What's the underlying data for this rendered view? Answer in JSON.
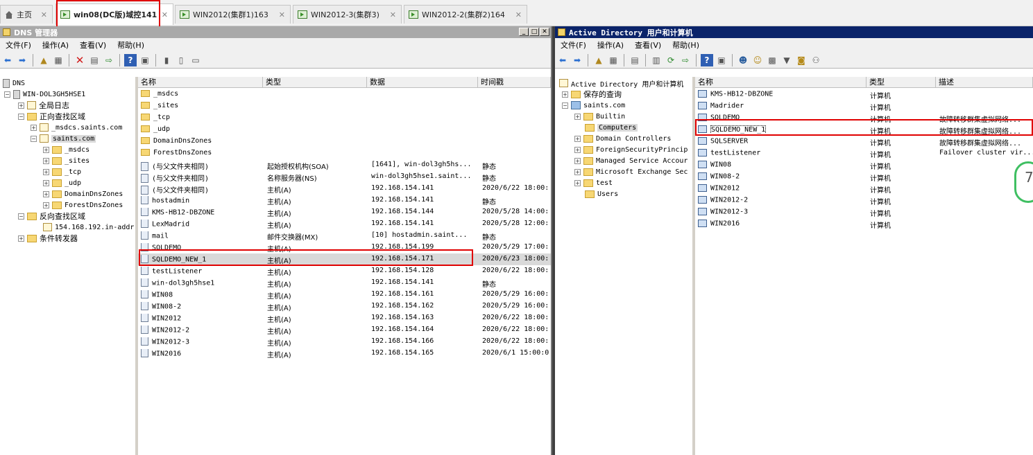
{
  "tabs": [
    {
      "label": "主页"
    },
    {
      "label": "win08(DC版)域控141"
    },
    {
      "label": "WIN2012(集群1)163"
    },
    {
      "label": "WIN2012-3(集群3)"
    },
    {
      "label": "WIN2012-2(集群2)164"
    }
  ],
  "dns": {
    "title": "DNS 管理器",
    "menu": [
      "文件(F)",
      "操作(A)",
      "查看(V)",
      "帮助(H)"
    ],
    "tree": [
      {
        "label": "DNS"
      },
      {
        "label": "WIN-DOL3GH5HSE1"
      },
      {
        "label": "全局日志"
      },
      {
        "label": "正向查找区域"
      },
      {
        "label": "_msdcs.saints.com"
      },
      {
        "label": "saints.com"
      },
      {
        "label": "_msdcs"
      },
      {
        "label": "_sites"
      },
      {
        "label": "_tcp"
      },
      {
        "label": "_udp"
      },
      {
        "label": "DomainDnsZones"
      },
      {
        "label": "ForestDnsZones"
      },
      {
        "label": "反向查找区域"
      },
      {
        "label": "154.168.192.in-addr"
      },
      {
        "label": "条件转发器"
      }
    ],
    "columns": [
      "名称",
      "类型",
      "数据",
      "时间戳"
    ],
    "rows": [
      {
        "name": "_msdcs",
        "type": "",
        "data": "",
        "time": ""
      },
      {
        "name": "_sites",
        "type": "",
        "data": "",
        "time": ""
      },
      {
        "name": "_tcp",
        "type": "",
        "data": "",
        "time": ""
      },
      {
        "name": "_udp",
        "type": "",
        "data": "",
        "time": ""
      },
      {
        "name": "DomainDnsZones",
        "type": "",
        "data": "",
        "time": ""
      },
      {
        "name": "ForestDnsZones",
        "type": "",
        "data": "",
        "time": ""
      },
      {
        "name": "(与父文件夹相同)",
        "type": "起始授权机构(SOA)",
        "data": "[1641], win-dol3gh5hs...",
        "time": "静态"
      },
      {
        "name": "(与父文件夹相同)",
        "type": "名称服务器(NS)",
        "data": "win-dol3gh5hse1.saint...",
        "time": "静态"
      },
      {
        "name": "(与父文件夹相同)",
        "type": "主机(A)",
        "data": "192.168.154.141",
        "time": "2020/6/22 18:00:"
      },
      {
        "name": "hostadmin",
        "type": "主机(A)",
        "data": "192.168.154.141",
        "time": "静态"
      },
      {
        "name": "KMS-HB12-DBZONE",
        "type": "主机(A)",
        "data": "192.168.154.144",
        "time": "2020/5/28 14:00:"
      },
      {
        "name": "LexMadrid",
        "type": "主机(A)",
        "data": "192.168.154.141",
        "time": "2020/5/28 12:00:"
      },
      {
        "name": "mail",
        "type": "邮件交换器(MX)",
        "data": "[10]  hostadmin.saint...",
        "time": "静态"
      },
      {
        "name": "SQLDEMO",
        "type": "主机(A)",
        "data": "192.168.154.199",
        "time": "2020/5/29 17:00:"
      },
      {
        "name": "SQLDEMO_NEW_1",
        "type": "主机(A)",
        "data": "192.168.154.171",
        "time": "2020/6/23 18:00:"
      },
      {
        "name": "testListener",
        "type": "主机(A)",
        "data": "192.168.154.128",
        "time": "2020/6/22 18:00:"
      },
      {
        "name": "win-dol3gh5hse1",
        "type": "主机(A)",
        "data": "192.168.154.141",
        "time": "静态"
      },
      {
        "name": "WIN08",
        "type": "主机(A)",
        "data": "192.168.154.161",
        "time": "2020/5/29 16:00:"
      },
      {
        "name": "WIN08-2",
        "type": "主机(A)",
        "data": "192.168.154.162",
        "time": "2020/5/29 16:00:"
      },
      {
        "name": "WIN2012",
        "type": "主机(A)",
        "data": "192.168.154.163",
        "time": "2020/6/22 18:00:"
      },
      {
        "name": "WIN2012-2",
        "type": "主机(A)",
        "data": "192.168.154.164",
        "time": "2020/6/22 18:00:"
      },
      {
        "name": "WIN2012-3",
        "type": "主机(A)",
        "data": "192.168.154.166",
        "time": "2020/6/22 18:00:"
      },
      {
        "name": "WIN2016",
        "type": "主机(A)",
        "data": "192.168.154.165",
        "time": "2020/6/1 15:00:0"
      }
    ]
  },
  "ad": {
    "title": "Active Directory 用户和计算机",
    "menu": [
      "文件(F)",
      "操作(A)",
      "查看(V)",
      "帮助(H)"
    ],
    "tree": [
      {
        "label": "Active Directory 用户和计算机"
      },
      {
        "label": "保存的查询"
      },
      {
        "label": "saints.com"
      },
      {
        "label": "Builtin"
      },
      {
        "label": "Computers"
      },
      {
        "label": "Domain Controllers"
      },
      {
        "label": "ForeignSecurityPrincip"
      },
      {
        "label": "Managed Service Accour"
      },
      {
        "label": "Microsoft Exchange Sec"
      },
      {
        "label": "test"
      },
      {
        "label": "Users"
      }
    ],
    "columns": [
      "名称",
      "类型",
      "描述"
    ],
    "rows": [
      {
        "name": "KMS-HB12-DBZONE",
        "type": "计算机",
        "desc": ""
      },
      {
        "name": "Madrider",
        "type": "计算机",
        "desc": ""
      },
      {
        "name": "SQLDEMO",
        "type": "计算机",
        "desc": "故障转移群集虚拟网络..."
      },
      {
        "name": "SQLDEMO_NEW_1",
        "type": "计算机",
        "desc": "故障转移群集虚拟网络..."
      },
      {
        "name": "SQLSERVER",
        "type": "计算机",
        "desc": "故障转移群集虚拟网络..."
      },
      {
        "name": "testListener",
        "type": "计算机",
        "desc": "Failover cluster vir..."
      },
      {
        "name": "WIN08",
        "type": "计算机",
        "desc": ""
      },
      {
        "name": "WIN08-2",
        "type": "计算机",
        "desc": ""
      },
      {
        "name": "WIN2012",
        "type": "计算机",
        "desc": ""
      },
      {
        "name": "WIN2012-2",
        "type": "计算机",
        "desc": ""
      },
      {
        "name": "WIN2012-3",
        "type": "计算机",
        "desc": ""
      },
      {
        "name": "WIN2016",
        "type": "计算机",
        "desc": ""
      }
    ]
  },
  "gauge": {
    "value": "7"
  },
  "colors": {
    "highlight": "#e00000",
    "titlebar_active": "#0b246a",
    "titlebar_inactive": "#a9a9a9",
    "selection": "#d9d9d9"
  }
}
